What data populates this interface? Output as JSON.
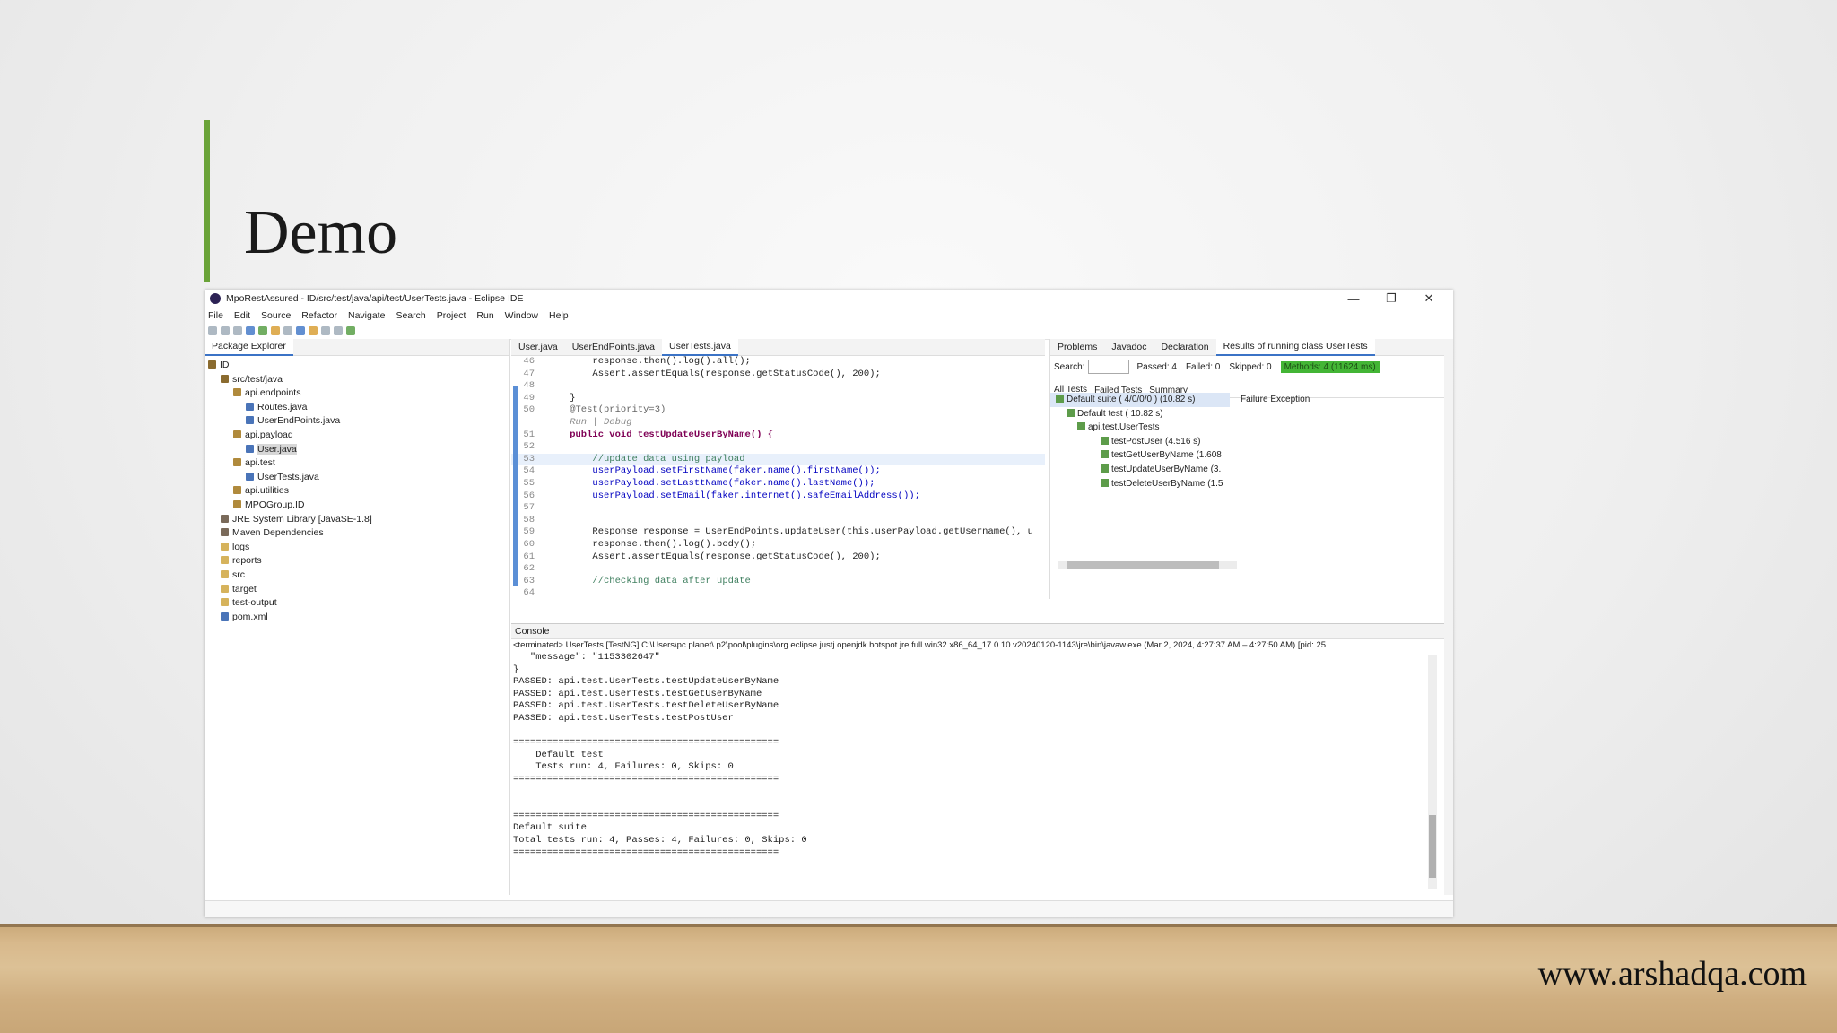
{
  "slide": {
    "title": "Demo",
    "footer_url": "www.arshadqa.com"
  },
  "window": {
    "title": "MpoRestAssured - ID/src/test/java/api/test/UserTests.java - Eclipse IDE",
    "minimize": "—",
    "maximize": "❐",
    "close": "✕"
  },
  "menu": [
    "File",
    "Edit",
    "Source",
    "Refactor",
    "Navigate",
    "Search",
    "Project",
    "Run",
    "Window",
    "Help"
  ],
  "package_explorer": {
    "tab_label": "Package Explorer",
    "nodes": [
      "ID",
      "src/test/java",
      "api.endpoints",
      "Routes.java",
      "UserEndPoints.java",
      "api.payload",
      "User.java",
      "api.test",
      "UserTests.java",
      "api.utilities",
      "MPOGroup.ID",
      "JRE System Library [JavaSE-1.8]",
      "Maven Dependencies",
      "logs",
      "reports",
      "src",
      "target",
      "test-output",
      "pom.xml"
    ]
  },
  "editor": {
    "tabs": [
      "User.java",
      "UserEndPoints.java",
      "UserTests.java"
    ],
    "lines": [
      {
        "n": "46",
        "text": "        response.then().log().all();"
      },
      {
        "n": "47",
        "text": "        Assert.assertEquals(response.getStatusCode(), 200);"
      },
      {
        "n": "48",
        "text": ""
      },
      {
        "n": "49",
        "text": "    }"
      },
      {
        "n": "50",
        "text": "    @Test(priority=3)"
      },
      {
        "n": "",
        "text": "    Run | Debug"
      },
      {
        "n": "51",
        "text": "    public void testUpdateUserByName() {"
      },
      {
        "n": "52",
        "text": ""
      },
      {
        "n": "53",
        "text": "        //update data using payload"
      },
      {
        "n": "54",
        "text": "        userPayload.setFirstName(faker.name().firstName());"
      },
      {
        "n": "55",
        "text": "        userPayload.setLasttName(faker.name().lastName());"
      },
      {
        "n": "56",
        "text": "        userPayload.setEmail(faker.internet().safeEmailAddress());"
      },
      {
        "n": "57",
        "text": ""
      },
      {
        "n": "58",
        "text": ""
      },
      {
        "n": "59",
        "text": "        Response response = UserEndPoints.updateUser(this.userPayload.getUsername(), u"
      },
      {
        "n": "60",
        "text": "        response.then().log().body();"
      },
      {
        "n": "61",
        "text": "        Assert.assertEquals(response.getStatusCode(), 200);"
      },
      {
        "n": "62",
        "text": ""
      },
      {
        "n": "63",
        "text": "        //checking data after update"
      },
      {
        "n": "64",
        "text": ""
      }
    ]
  },
  "results": {
    "tabs": [
      "Problems",
      "Javadoc",
      "Declaration",
      "Results of running class UserTests"
    ],
    "search_label": "Search:",
    "passed": "Passed: 4",
    "failed": "Failed: 0",
    "skipped": "Skipped: 0",
    "methods": "Methods: 4 (11624 ms)",
    "subtabs": [
      "All Tests",
      "Failed Tests",
      "Summary"
    ],
    "tree": [
      "Default suite ( 4/0/0/0 ) (10.82 s)",
      "Default test ( 10.82 s)",
      "api.test.UserTests",
      "testPostUser  (4.516 s)",
      "testGetUserByName  (1.608",
      "testUpdateUserByName  (3.",
      "testDeleteUserByName  (1.5"
    ],
    "failure_label": "Failure Exception"
  },
  "console": {
    "tab_label": "Console",
    "terminated": "<terminated> UserTests [TestNG] C:\\Users\\pc planet\\.p2\\pool\\plugins\\org.eclipse.justj.openjdk.hotspot.jre.full.win32.x86_64_17.0.10.v20240120-1143\\jre\\bin\\javaw.exe  (Mar 2, 2024, 4:27:37 AM – 4:27:50 AM) [pid: 25",
    "lines": [
      "   \"message\": \"1153302647\"",
      "}",
      "PASSED: api.test.UserTests.testUpdateUserByName",
      "PASSED: api.test.UserTests.testGetUserByName",
      "PASSED: api.test.UserTests.testDeleteUserByName",
      "PASSED: api.test.UserTests.testPostUser",
      "",
      "===============================================",
      "    Default test",
      "    Tests run: 4, Failures: 0, Skips: 0",
      "===============================================",
      "",
      "",
      "===============================================",
      "Default suite",
      "Total tests run: 4, Passes: 4, Failures: 0, Skips: 0",
      "==============================================="
    ]
  },
  "colors": {
    "accent": "#6aa338",
    "pass_badge": "#43b535"
  }
}
